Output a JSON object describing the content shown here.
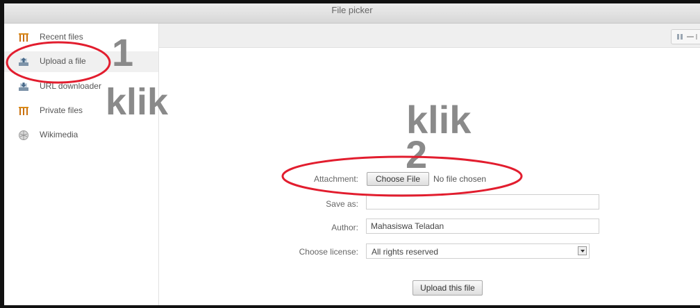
{
  "window": {
    "title": "File picker"
  },
  "sidebar": {
    "items": [
      {
        "label": "Recent files",
        "icon": "moodle-icon"
      },
      {
        "label": "Upload a file",
        "icon": "upload-icon"
      },
      {
        "label": "URL downloader",
        "icon": "url-download-icon"
      },
      {
        "label": "Private files",
        "icon": "moodle-icon"
      },
      {
        "label": "Wikimedia",
        "icon": "wikimedia-icon"
      }
    ]
  },
  "toolbar": {
    "view_buttons_icon": "view-mode-icon"
  },
  "annotations": {
    "step1_number": "1",
    "step1_text": "klik",
    "step2_text": "klik",
    "step2_number": "2",
    "highlight_color": "#e21d2e"
  },
  "form": {
    "attachment_label": "Attachment:",
    "choose_file_label": "Choose File",
    "no_file_text": "No file chosen",
    "save_as_label": "Save as:",
    "save_as_value": "",
    "author_label": "Author:",
    "author_value": "Mahasiswa Teladan",
    "license_label": "Choose license:",
    "license_value": "All rights reserved",
    "upload_button": "Upload this file"
  }
}
